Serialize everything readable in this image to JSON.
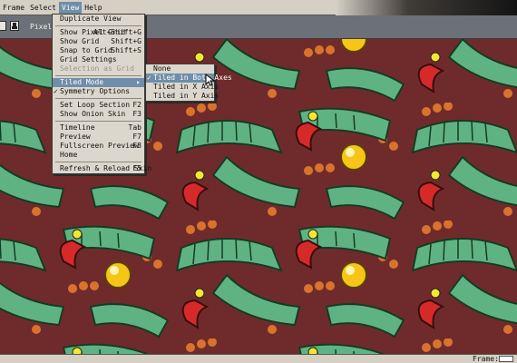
{
  "menubar": {
    "items": [
      "Frame",
      "Select",
      "View",
      "Help"
    ],
    "active_index": 2
  },
  "toolbar": {
    "label": "Pixel-pe"
  },
  "view_menu": {
    "items": [
      {
        "label": "Duplicate View",
        "shortcut": "",
        "sep_after": true
      },
      {
        "label": "Show Pixel Grid",
        "shortcut": "Alt+Shift+G"
      },
      {
        "label": "Show Grid",
        "shortcut": "Shift+G"
      },
      {
        "label": "Snap to Grid",
        "shortcut": "Shift+S"
      },
      {
        "label": "Grid Settings",
        "shortcut": ""
      },
      {
        "label": "Selection as Grid",
        "shortcut": "",
        "disabled": true,
        "sep_after": true
      },
      {
        "label": "Tiled Mode",
        "shortcut": "",
        "submenu": true,
        "selected": true
      },
      {
        "label": "Symmetry Options",
        "shortcut": "",
        "checked": true,
        "sep_after": true
      },
      {
        "label": "Set Loop Section",
        "shortcut": "F2"
      },
      {
        "label": "Show Onion Skin",
        "shortcut": "F3",
        "sep_after": true
      },
      {
        "label": "Timeline",
        "shortcut": "Tab"
      },
      {
        "label": "Preview",
        "shortcut": "F7"
      },
      {
        "label": "Fullscreen Preview",
        "shortcut": "F8"
      },
      {
        "label": "Home",
        "shortcut": "",
        "sep_after": true
      },
      {
        "label": "Refresh & Reload Skin",
        "shortcut": "F5"
      }
    ]
  },
  "tiled_submenu": {
    "items": [
      {
        "label": "None",
        "checked": false,
        "selected": false
      },
      {
        "label": "Tiled in Both Axes",
        "checked": true,
        "selected": true
      },
      {
        "label": "Tiled in X Axis",
        "checked": false,
        "selected": false
      },
      {
        "label": "Tiled in Y Axis",
        "checked": false,
        "selected": false
      }
    ]
  },
  "statusbar": {
    "frame_label": "Frame:",
    "frame_value": ""
  },
  "colors": {
    "canvas_bg": "#6f2b2b",
    "menu_bg": "#dcd7cc",
    "highlight": "#6f8eaa",
    "dragon_green": "#5fb383",
    "egg_yellow": "#f5c518"
  },
  "icons": [
    "cursor-arrow-icon",
    "check-icon",
    "submenu-arrow-icon"
  ]
}
